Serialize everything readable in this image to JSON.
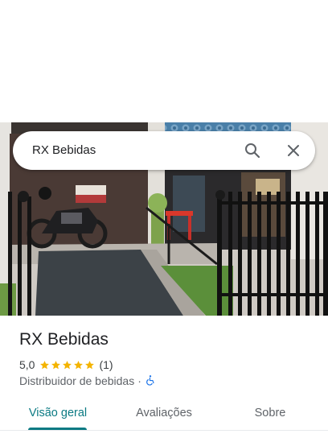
{
  "search": {
    "query": "RX Bebidas",
    "search_icon": "search-icon",
    "close_icon": "close-icon"
  },
  "place": {
    "name": "RX Bebidas",
    "rating": "5,0",
    "rating_stars": 5,
    "review_count": "(1)",
    "category": "Distribuidor de bebidas",
    "separator": "·",
    "accessibility_icon": "wheelchair-icon",
    "star_color": "#f4b400",
    "accessibility_color": "#1a73e8"
  },
  "tabs": [
    {
      "label": "Visão geral",
      "active": true
    },
    {
      "label": "Avaliações",
      "active": false
    },
    {
      "label": "Sobre",
      "active": false
    }
  ],
  "colors": {
    "accent": "#0b7a83",
    "text_primary": "#202124",
    "text_secondary": "#5f6368"
  }
}
